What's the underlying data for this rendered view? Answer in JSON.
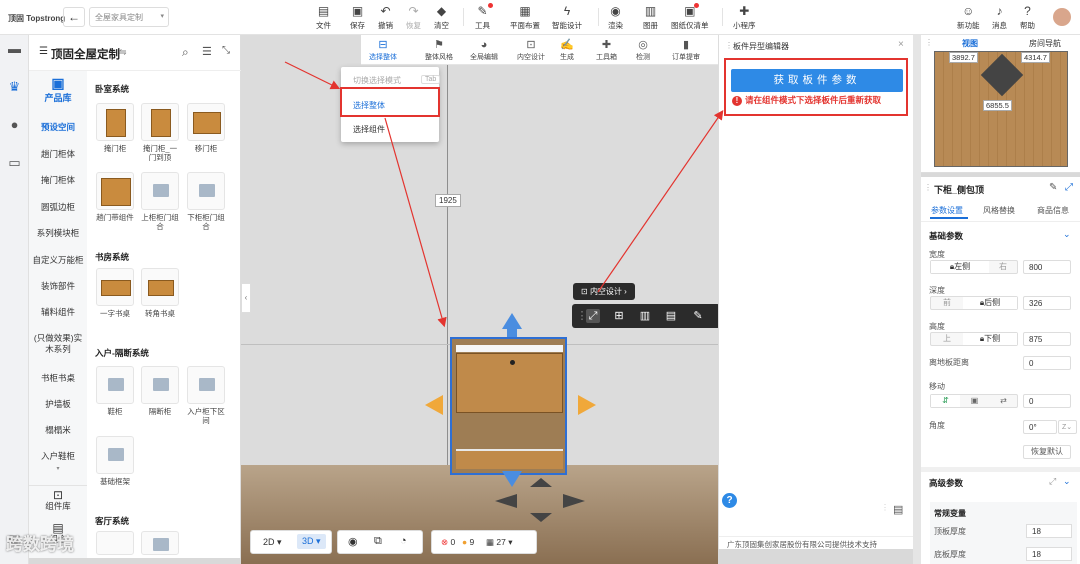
{
  "topbar": {
    "brand": "顶固 Topstrong",
    "back_icon": "arrow-left",
    "scheme_name": "全屋家具定制",
    "tools": [
      {
        "label": "文件",
        "icon": "file-icon"
      },
      {
        "label": "保存",
        "icon": "save-icon"
      },
      {
        "label": "撤销",
        "icon": "undo-icon"
      },
      {
        "label": "恢复",
        "icon": "redo-icon"
      },
      {
        "label": "清空",
        "icon": "eraser-icon"
      },
      {
        "label": "工具",
        "icon": "wrench-icon"
      },
      {
        "label": "平面布置",
        "icon": "layout-icon"
      },
      {
        "label": "智能设计",
        "icon": "bolt-icon"
      },
      {
        "label": "渲染",
        "icon": "camera-icon"
      },
      {
        "label": "图册",
        "icon": "album-icon"
      },
      {
        "label": "图纸仅清单",
        "icon": "drawing-icon"
      },
      {
        "label": "小程序",
        "icon": "puzzle-icon"
      }
    ],
    "right": [
      {
        "label": "新功能",
        "icon": "new-feature-icon"
      },
      {
        "label": "消息",
        "icon": "bell-icon"
      },
      {
        "label": "帮助",
        "icon": "help-icon"
      }
    ]
  },
  "library": {
    "title": "顶固全屋定制",
    "product_lib": "产品库",
    "categories": [
      "预设空间",
      "趟门柜体",
      "掩门柜体",
      "圆弧边柜",
      "系列模块柜",
      "自定义万能柜",
      "装饰部件",
      "辅料组件",
      "(只做效果)实木系列",
      "书柜书桌",
      "护墙板",
      "榻榻米",
      "入户鞋柜",
      "组件库",
      "组合"
    ],
    "sections": [
      {
        "title": "卧室系统",
        "items": [
          "掩门柜",
          "掩门柜_一门到顶",
          "移门柜",
          "趟门带组件",
          "上柜柜门组合",
          "下柜柜门组合"
        ]
      },
      {
        "title": "书房系统",
        "items": [
          "一字书桌",
          "转角书桌"
        ]
      },
      {
        "title": "入户-隔断系统",
        "items": [
          "鞋柜",
          "隔断柜",
          "入户柜下区间",
          "基础框架"
        ]
      },
      {
        "title": "客厅系统",
        "items": []
      }
    ]
  },
  "canvas": {
    "dimension_label": "1925",
    "pill_label": "内空设计",
    "view_2d": "2D",
    "view_3d": "3D",
    "errors": "0",
    "warnings": "9",
    "calendar_count": "27"
  },
  "toolbar2": {
    "items": [
      "选择整体",
      "整体风格",
      "全局编辑",
      "内空设计",
      "生成",
      "工具箱",
      "检测",
      "订单提审"
    ],
    "active": "选择整体"
  },
  "dropdown": {
    "hint": "切换选择模式",
    "hint_key": "Tab",
    "opt1": "选择整体",
    "opt2": "选择组件"
  },
  "editor": {
    "title": "板件异型编辑器",
    "button": "获取板件参数",
    "warning": "请在组件模式下选择板件后重新获取",
    "footer": "广东顶固集创家居股份有限公司提供技术支持"
  },
  "minimap": {
    "tab_view": "视图",
    "tab_room": "房间导航",
    "labels": [
      "3892.7",
      "4314.7",
      "6855.5"
    ]
  },
  "props": {
    "title": "下柜_侧包顶",
    "tabs": [
      "参数设置",
      "风格替换",
      "商品信息"
    ],
    "basic_section": "基础参数",
    "width_label": "宽度",
    "width_a": "左侧",
    "width_b": "右",
    "width_value": "800",
    "depth_label": "深度",
    "depth_a": "前",
    "depth_b": "后侧",
    "depth_value": "326",
    "height_label": "高度",
    "height_a": "上",
    "height_b": "下侧",
    "height_value": "875",
    "offground_label": "离地板距离",
    "offground_value": "0",
    "move_label": "移动",
    "move_value": "0",
    "angle_label": "角度",
    "angle_value": "0°",
    "angle_axis": "Z",
    "reset_label": "恢复默认",
    "advanced_section": "高级参数",
    "common_var": "常规变量",
    "top_thick_label": "顶板厚度",
    "top_thick_value": "18",
    "bottom_thick_label": "底板厚度",
    "bottom_thick_value": "18"
  },
  "watermark": "跨数跨境"
}
